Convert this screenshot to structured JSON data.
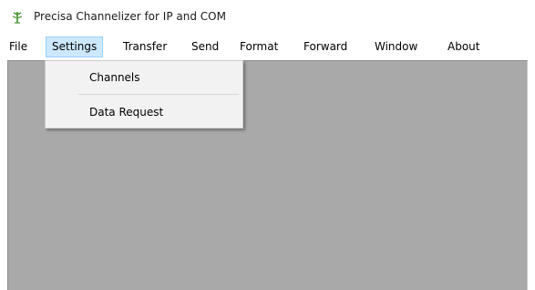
{
  "window": {
    "title": "Precisa Channelizer for IP and COM",
    "icon": "plant-sprout-icon"
  },
  "menubar": {
    "items": [
      {
        "label": "File"
      },
      {
        "label": "Settings",
        "active": true
      },
      {
        "label": "Transfer"
      },
      {
        "label": "Send"
      },
      {
        "label": "Format"
      },
      {
        "label": "Forward"
      },
      {
        "label": "Window"
      },
      {
        "label": "About"
      }
    ]
  },
  "settings_menu": {
    "items": [
      {
        "label": "Channels"
      },
      {
        "label": "Data Request"
      }
    ]
  },
  "colors": {
    "client_area": "#a9a9a9",
    "menu_highlight": "#cce8ff",
    "dropdown_bg": "#f2f2f2",
    "icon_green": "#3e8e2e"
  }
}
